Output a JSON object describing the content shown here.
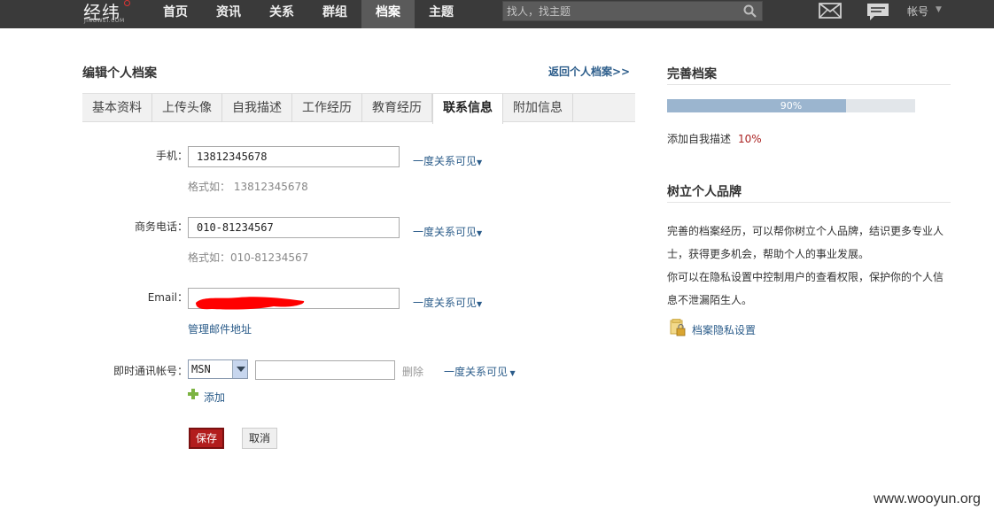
{
  "topbar": {
    "logo_text": "经纬",
    "logo_sub": "JINGWEI.COM",
    "nav": [
      {
        "label": "首页",
        "active": false
      },
      {
        "label": "资讯",
        "active": false
      },
      {
        "label": "关系",
        "active": false
      },
      {
        "label": "群组",
        "active": false
      },
      {
        "label": "档案",
        "active": true
      },
      {
        "label": "主题",
        "active": false
      }
    ],
    "search_placeholder": "找人，找主题",
    "account_label": "帐号",
    "icons": [
      "search-icon",
      "mail-icon",
      "message-icon",
      "chevron-down-icon"
    ]
  },
  "main": {
    "title": "编辑个人档案",
    "back_link": "返回个人档案>>",
    "tabs": [
      {
        "label": "基本资料",
        "active": false
      },
      {
        "label": "上传头像",
        "active": false
      },
      {
        "label": "自我描述",
        "active": false
      },
      {
        "label": "工作经历",
        "active": false
      },
      {
        "label": "教育经历",
        "active": false
      },
      {
        "label": "联系信息",
        "active": true
      },
      {
        "label": "附加信息",
        "active": false
      }
    ],
    "form": {
      "mobile": {
        "label": "手机：",
        "value": "13812345678",
        "visibility": "一度关系可见",
        "hint": "格式如：  13812345678"
      },
      "business_phone": {
        "label": "商务电话：",
        "value": "010-81234567",
        "visibility": "一度关系可见",
        "hint": "格式如：010-81234567"
      },
      "email": {
        "label": "Email：",
        "value": "",
        "visibility": "一度关系可见",
        "manage_link": "管理邮件地址"
      },
      "im": {
        "label": "即时通讯帐号：",
        "selected": "MSN",
        "value": "",
        "delete_label": "删除",
        "visibility": "一度关系可见",
        "add_label": "添加"
      },
      "save_label": "保存",
      "cancel_label": "取消"
    }
  },
  "sidebar": {
    "complete_title": "完善档案",
    "progress": {
      "value": 0.9,
      "label": "90%"
    },
    "complete_item": {
      "label": "添加自我描述",
      "percent": "10%"
    },
    "brand_title": "树立个人品牌",
    "brand_text_1": "完善的档案经历，可以帮你树立个人品牌，结识更多专业人士，获得更多机会，帮助个人的事业发展。",
    "brand_text_2": "你可以在隐私设置中控制用户的查看权限，保护你的个人信息不泄漏陌生人。",
    "privacy_link": "档案隐私设置"
  },
  "watermark": "www.wooyun.org",
  "colors": {
    "topbar_bg": "#3a3a3a",
    "link": "#2b5c8a",
    "save_button": "#b21d1d",
    "progress_fill": "#9bb5cf",
    "redaction": "#ff0000"
  }
}
